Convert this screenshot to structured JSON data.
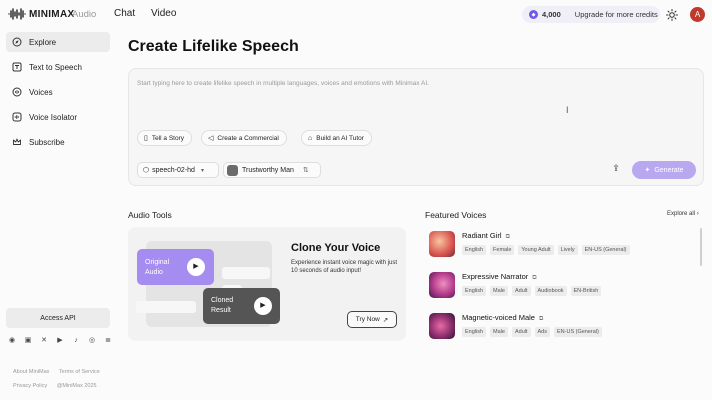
{
  "brand": {
    "logo": "MINIMAX",
    "product": "Audio"
  },
  "topnav": [
    "Chat",
    "Video"
  ],
  "credits": {
    "amount": "4,000",
    "upgrade_label": "Upgrade for more credits"
  },
  "user": {
    "initial": "A"
  },
  "sidebar": {
    "items": [
      {
        "label": "Explore",
        "icon": "compass-icon"
      },
      {
        "label": "Text to Speech",
        "icon": "text-icon"
      },
      {
        "label": "Voices",
        "icon": "voices-icon"
      },
      {
        "label": "Voice Isolator",
        "icon": "isolator-icon"
      },
      {
        "label": "Subscribe",
        "icon": "crown-icon"
      }
    ],
    "access_api": "Access API",
    "footer": {
      "about": "About MiniMax",
      "terms": "Terms of Service",
      "privacy": "Privacy Policy",
      "copyright": "@MiniMax 2025"
    }
  },
  "main": {
    "title": "Create Lifelike Speech",
    "prompt_placeholder": "Start typing here to create lifelike speech in multiple languages, voices and emotions with Minimax AI.",
    "suggestions": [
      "Tell a Story",
      "Create a Commercial",
      "Build an AI Tutor"
    ],
    "model": "speech-02-hd",
    "voice": "Trustworthy Man",
    "generate_label": "Generate"
  },
  "audio_tools": {
    "title": "Audio Tools",
    "original_label": "Original Audio",
    "cloned_label": "Cloned Result",
    "clone_title": "Clone Your Voice",
    "clone_desc": "Experience instant voice magic with just 10 seconds of audio input!",
    "try_label": "Try Now"
  },
  "featured": {
    "title": "Featured Voices",
    "explore_all": "Explore all",
    "voices": [
      {
        "name": "Radiant Girl",
        "tags": [
          "English",
          "Female",
          "Young Adult",
          "Lively",
          "EN-US (General)"
        ]
      },
      {
        "name": "Expressive Narrator",
        "tags": [
          "English",
          "Male",
          "Adult",
          "Audiobook",
          "EN-British"
        ]
      },
      {
        "name": "Magnetic-voiced Male",
        "tags": [
          "English",
          "Male",
          "Adult",
          "Ads",
          "EN-US (General)"
        ]
      }
    ]
  },
  "colors": {
    "accent": "#a48cf0",
    "generate": "#b9a7f0",
    "avatar": "#c0392b"
  }
}
